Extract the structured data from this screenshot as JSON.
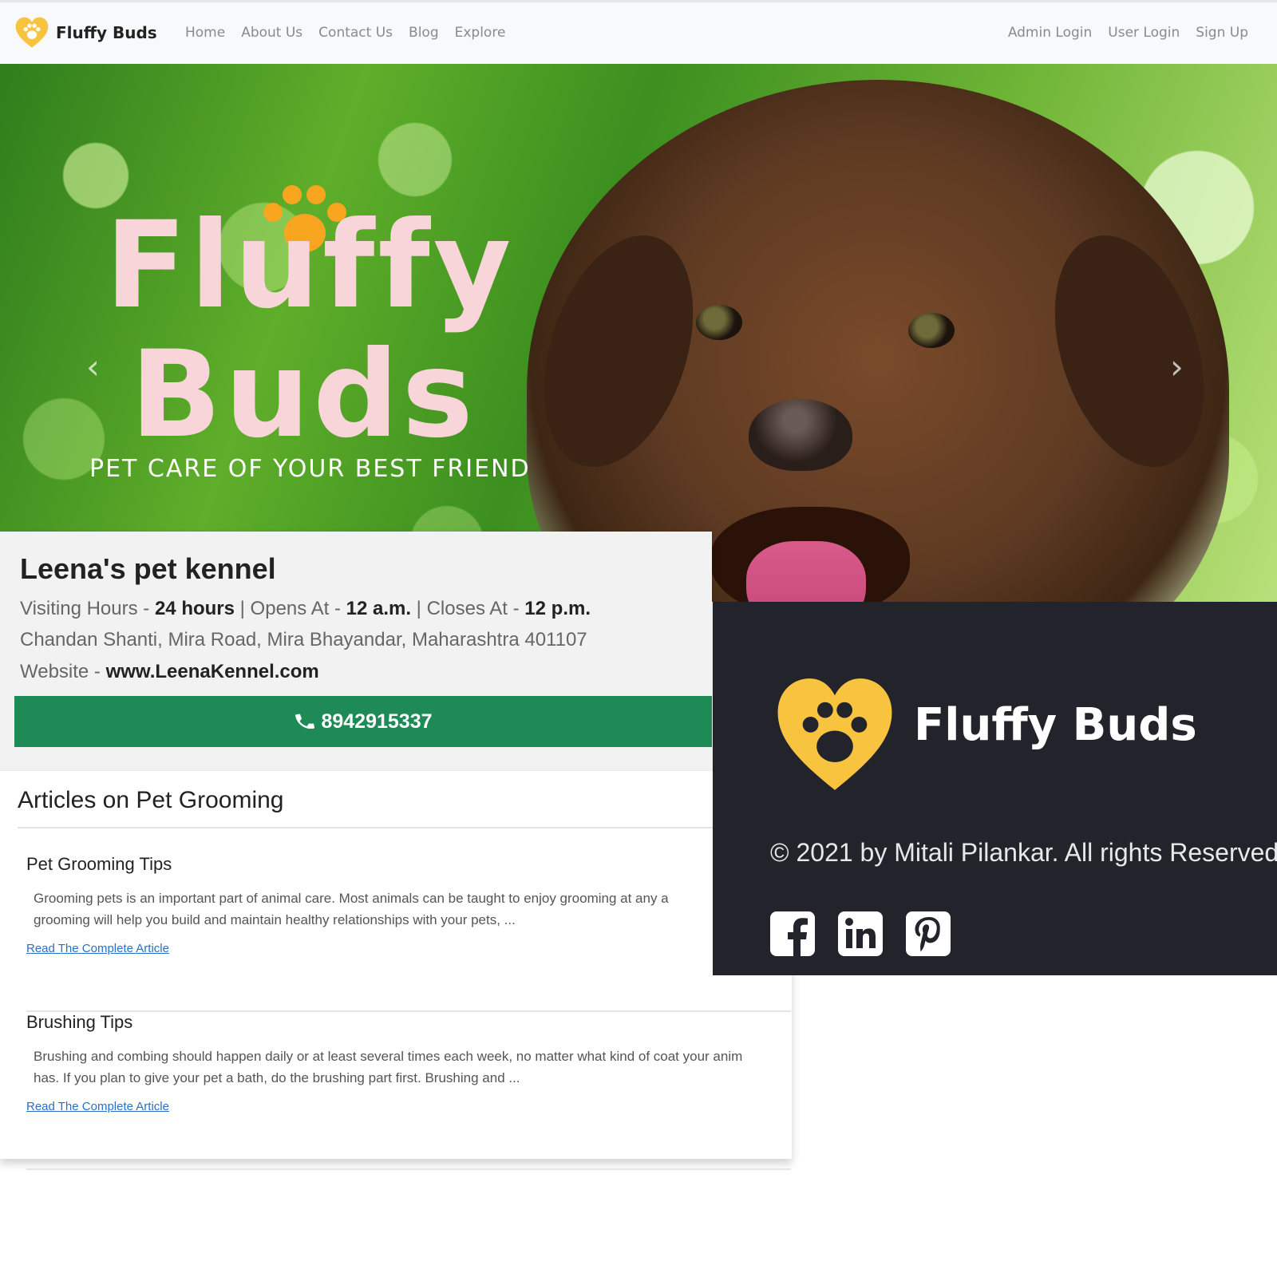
{
  "brand": {
    "name": "Fluffy Buds",
    "accent_color": "#f8c33f"
  },
  "nav": {
    "links": [
      "Home",
      "About Us",
      "Contact Us",
      "Blog",
      "Explore"
    ],
    "right_links": [
      "Admin Login",
      "User Login",
      "Sign Up"
    ]
  },
  "hero": {
    "title_line1": "Fluffy",
    "title_line2": "Buds",
    "tagline": "PET CARE OF YOUR BEST FRIEND",
    "prev_icon": "chevron-left-icon",
    "next_icon": "chevron-right-icon",
    "prev_glyph": "‹",
    "next_glyph": "›"
  },
  "kennel": {
    "name": "Leena's pet kennel",
    "visiting_label": "Visiting Hours - ",
    "visiting_value": "24 hours",
    "opens_label": " | Opens At - ",
    "opens_value": "12 a.m.",
    "closes_label": " | Closes At - ",
    "closes_value": "12 p.m.",
    "address": "Chandan Shanti, Mira Road, Mira Bhayandar, Maharashtra 401107",
    "website_label": "Website - ",
    "website_value": "www.LeenaKennel.com",
    "phone": "8942915337",
    "phone_button_color": "#1e8a56"
  },
  "articles": {
    "heading": "Articles on Pet Grooming",
    "items": [
      {
        "title": "Pet Grooming Tips",
        "body_line1": "Grooming pets is an important part of animal care. Most animals can be taught to enjoy grooming at any a",
        "body_line2": "grooming will help you build and maintain healthy relationships with your pets, ...",
        "link": "Read The Complete Article"
      },
      {
        "title": "Brushing Tips",
        "body_line1": "Brushing and combing should happen daily or at least several times each week, no matter what kind of coat your anim",
        "body_line2": "has. If you plan to give your pet a bath, do the brushing part first. Brushing and ...",
        "link": "Read The Complete Article"
      }
    ]
  },
  "footer": {
    "brand": "Fluffy Buds",
    "copyright": "© 2021 by Mitali Pilankar. All rights Reserved",
    "background": "#22232b",
    "social": [
      "facebook-icon",
      "linkedin-icon",
      "pinterest-icon"
    ]
  }
}
